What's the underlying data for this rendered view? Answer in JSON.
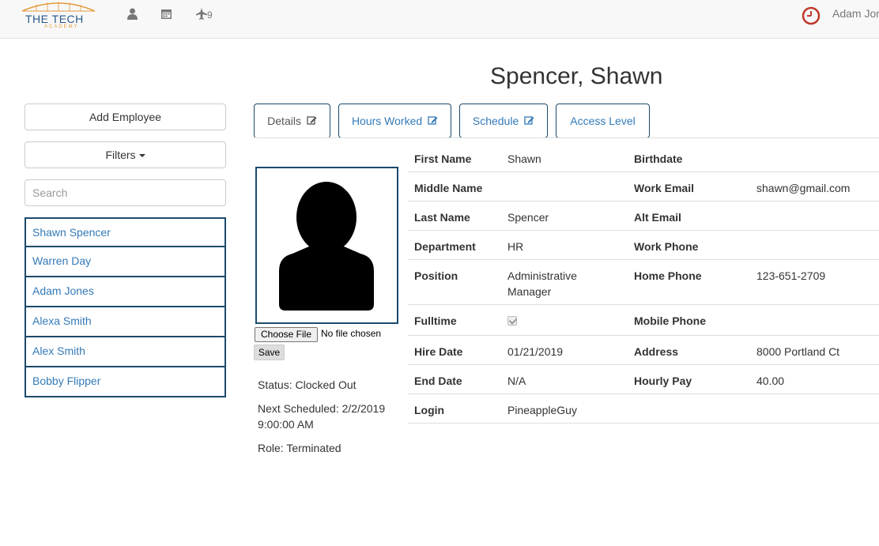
{
  "nav": {
    "logo_text": "THE TECH",
    "logo_sub": "ACADEMY",
    "notification_count": "9",
    "user_name": "Adam Jones",
    "icons": [
      "user-icon",
      "calendar-icon",
      "plane-icon",
      "clock-icon"
    ]
  },
  "page_title": "Spencer, Shawn",
  "sidebar": {
    "add_label": "Add Employee",
    "filters_label": "Filters",
    "search_placeholder": "Search",
    "employees": [
      "Shawn Spencer",
      "Warren Day",
      "Adam Jones",
      "Alexa Smith",
      "Alex Smith",
      "Bobby Flipper"
    ]
  },
  "tabs": {
    "details": "Details",
    "hours": "Hours Worked",
    "schedule": "Schedule",
    "access": "Access Level"
  },
  "profile": {
    "choose_file": "Choose File",
    "no_file": "No file chosen",
    "save": "Save",
    "status": "Status: Clocked Out",
    "next_scheduled": "Next Scheduled: 2/2/2019 9:00:00 AM",
    "role": "Role: Terminated"
  },
  "details": {
    "first_name_label": "First Name",
    "first_name": "Shawn",
    "birthdate_label": "Birthdate",
    "birthdate": "",
    "middle_name_label": "Middle Name",
    "middle_name": "",
    "work_email_label": "Work Email",
    "work_email": "shawn@gmail.com",
    "last_name_label": "Last Name",
    "last_name": "Spencer",
    "alt_email_label": "Alt Email",
    "alt_email": "",
    "department_label": "Department",
    "department": "HR",
    "work_phone_label": "Work Phone",
    "work_phone": "",
    "position_label": "Position",
    "position": "Administrative Manager",
    "home_phone_label": "Home Phone",
    "home_phone": "123-651-2709",
    "fulltime_label": "Fulltime",
    "fulltime": true,
    "mobile_phone_label": "Mobile Phone",
    "mobile_phone": "",
    "hire_date_label": "Hire Date",
    "hire_date": "01/21/2019",
    "address_label": "Address",
    "address": "8000 Portland Ct",
    "end_date_label": "End Date",
    "end_date": "N/A",
    "hourly_pay_label": "Hourly Pay",
    "hourly_pay": "40.00",
    "login_label": "Login",
    "login": "PineappleGuy"
  },
  "colors": {
    "link": "#337ab7",
    "border_dark": "#1b4a6b",
    "clock": "#c0392b",
    "logo_orange": "#e39a3b"
  }
}
